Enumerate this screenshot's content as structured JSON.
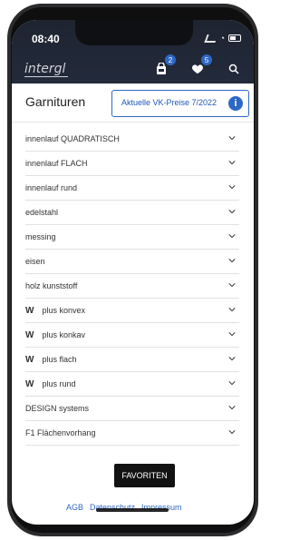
{
  "status": {
    "time": "08:40"
  },
  "brand": {
    "logo_text": "intergl"
  },
  "header_icons": {
    "bag_badge": "2",
    "heart_badge": "5"
  },
  "page": {
    "title": "Garnituren",
    "price_button_label": "Aktuelle VK-Preise 7/2022"
  },
  "sections": [
    {
      "label": "innenlauf QUADRATISCH"
    },
    {
      "label": "innenlauf FLACH"
    },
    {
      "label": "innenlauf rund"
    },
    {
      "label": "edelstahl"
    },
    {
      "label": "messing"
    },
    {
      "label": "eisen"
    },
    {
      "label": "holz kunststoff"
    },
    {
      "label": "plus konvex",
      "mark": "w"
    },
    {
      "label": "plus konkav",
      "mark": "w"
    },
    {
      "label": "plus flach",
      "mark": "w"
    },
    {
      "label": "plus rund",
      "mark": "w"
    },
    {
      "label": "DESIGN systems"
    },
    {
      "label": "F1 Flächenvorhang"
    }
  ],
  "actions": {
    "favorites_label": "FAVORITEN"
  },
  "footer_links": [
    {
      "label": "AGB"
    },
    {
      "label": "Datenschutz"
    },
    {
      "label": "Impressum"
    }
  ],
  "colors": {
    "accent": "#2e68c6",
    "header_bg": "#232a3b"
  },
  "icons": {
    "bag": "bag-icon",
    "heart": "heart-icon",
    "search": "search-icon",
    "info": "info-icon",
    "chevron": "chevron-down-icon"
  }
}
